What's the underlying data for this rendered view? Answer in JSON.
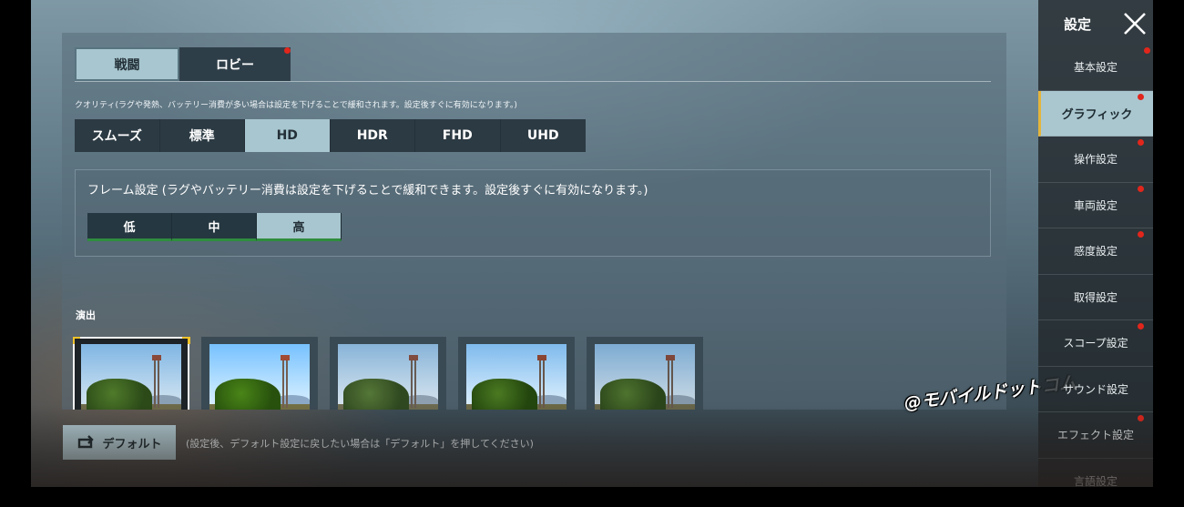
{
  "tabs": [
    {
      "label": "戦闘",
      "active": true,
      "notification": false
    },
    {
      "label": "ロビー",
      "active": false,
      "notification": true
    }
  ],
  "quality": {
    "note": "クオリティ(ラグや発熱、バッテリー消費が多い場合は設定を下げることで緩和されます。設定後すぐに有効になります。)",
    "options": [
      "スムーズ",
      "標準",
      "HD",
      "HDR",
      "FHD",
      "UHD"
    ],
    "selected": "HD"
  },
  "frame": {
    "title": "フレーム設定 (ラグやバッテリー消費は設定を下げることで緩和できます。設定後すぐに有効になります。)",
    "options": [
      "低",
      "中",
      "高"
    ],
    "selected": "高"
  },
  "effects": {
    "label": "演出",
    "selected_index": 0,
    "thumbnail_count": 5
  },
  "footer": {
    "default_label": "デフォルト",
    "note": "(設定後、デフォルト設定に戻したい場合は「デフォルト」を押してください)"
  },
  "watermark": "@モバイルドットコム",
  "sidebar": {
    "title": "設定",
    "items": [
      {
        "label": "基本設定",
        "active": false,
        "notification": true
      },
      {
        "label": "グラフィック",
        "active": true,
        "notification": true
      },
      {
        "label": "操作設定",
        "active": false,
        "notification": true
      },
      {
        "label": "車両設定",
        "active": false,
        "notification": true
      },
      {
        "label": "感度設定",
        "active": false,
        "notification": true
      },
      {
        "label": "取得設定",
        "active": false,
        "notification": false
      },
      {
        "label": "スコープ設定",
        "active": false,
        "notification": true
      },
      {
        "label": "サウンド設定",
        "active": false,
        "notification": false
      },
      {
        "label": "エフェクト設定",
        "active": false,
        "notification": true
      },
      {
        "label": "言語設定",
        "active": false,
        "notification": false
      }
    ]
  },
  "icons": {
    "close": "close-icon",
    "default": "reset-icon",
    "notification": "notification-dot-icon"
  },
  "colors": {
    "selected": "#a8c6cf",
    "notification": "#e1261c",
    "frame_underline": "#2f8c3e",
    "selection_corner": "#f0c22a"
  }
}
